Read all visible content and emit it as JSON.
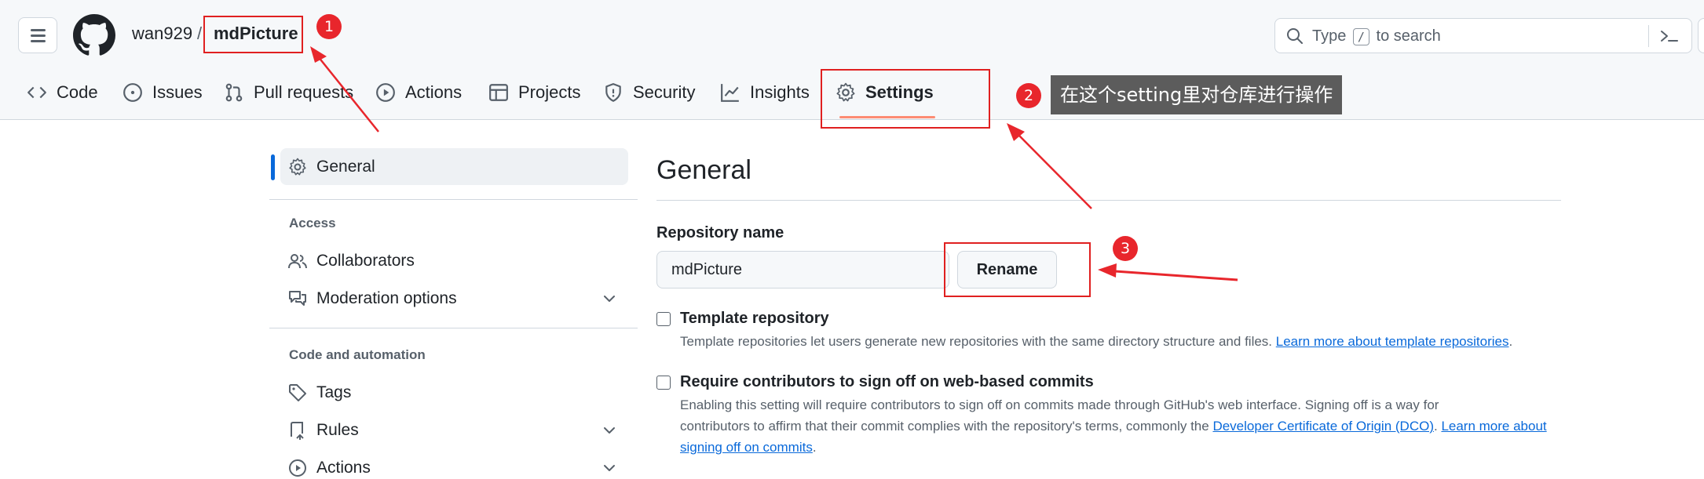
{
  "header": {
    "owner": "wan929",
    "separator": "/",
    "repo": "mdPicture",
    "search_prefix": "Type",
    "search_key": "/",
    "search_suffix": "to search"
  },
  "tabs": [
    {
      "label": "Code",
      "icon": "code-icon"
    },
    {
      "label": "Issues",
      "icon": "issue-icon"
    },
    {
      "label": "Pull requests",
      "icon": "pull-request-icon"
    },
    {
      "label": "Actions",
      "icon": "play-icon"
    },
    {
      "label": "Projects",
      "icon": "table-icon"
    },
    {
      "label": "Security",
      "icon": "shield-icon"
    },
    {
      "label": "Insights",
      "icon": "graph-icon"
    },
    {
      "label": "Settings",
      "icon": "gear-icon",
      "selected": true
    }
  ],
  "sidebar": {
    "general": "General",
    "access_heading": "Access",
    "collaborators": "Collaborators",
    "moderation": "Moderation options",
    "code_heading": "Code and automation",
    "tags": "Tags",
    "rules": "Rules",
    "actions": "Actions"
  },
  "main": {
    "title": "General",
    "repo_name_label": "Repository name",
    "repo_name_value": "mdPicture",
    "rename_button": "Rename",
    "template_title": "Template repository",
    "template_desc": "Template repositories let users generate new repositories with the same directory structure and files.",
    "template_link": "Learn more about template repositories",
    "signoff_title": "Require contributors to sign off on web-based commits",
    "signoff_desc_1": "Enabling this setting will require contributors to sign off on commits made through GitHub's web interface. Signing off is a way for",
    "signoff_desc_2": "contributors to affirm that their commit complies with the repository's terms, commonly the",
    "signoff_link_dco": "Developer Certificate of Origin (DCO)",
    "signoff_link_learn": "Learn more about signing off on commits"
  },
  "annotations": {
    "badge_1": "1",
    "badge_2": "2",
    "badge_3": "3",
    "callout": "在这个setting里对仓库进行操作",
    "color": "#e02020"
  },
  "colors": {
    "accent_link": "#0969da",
    "tab_underline": "#fd8c73",
    "header_bg": "#f6f8fa"
  }
}
